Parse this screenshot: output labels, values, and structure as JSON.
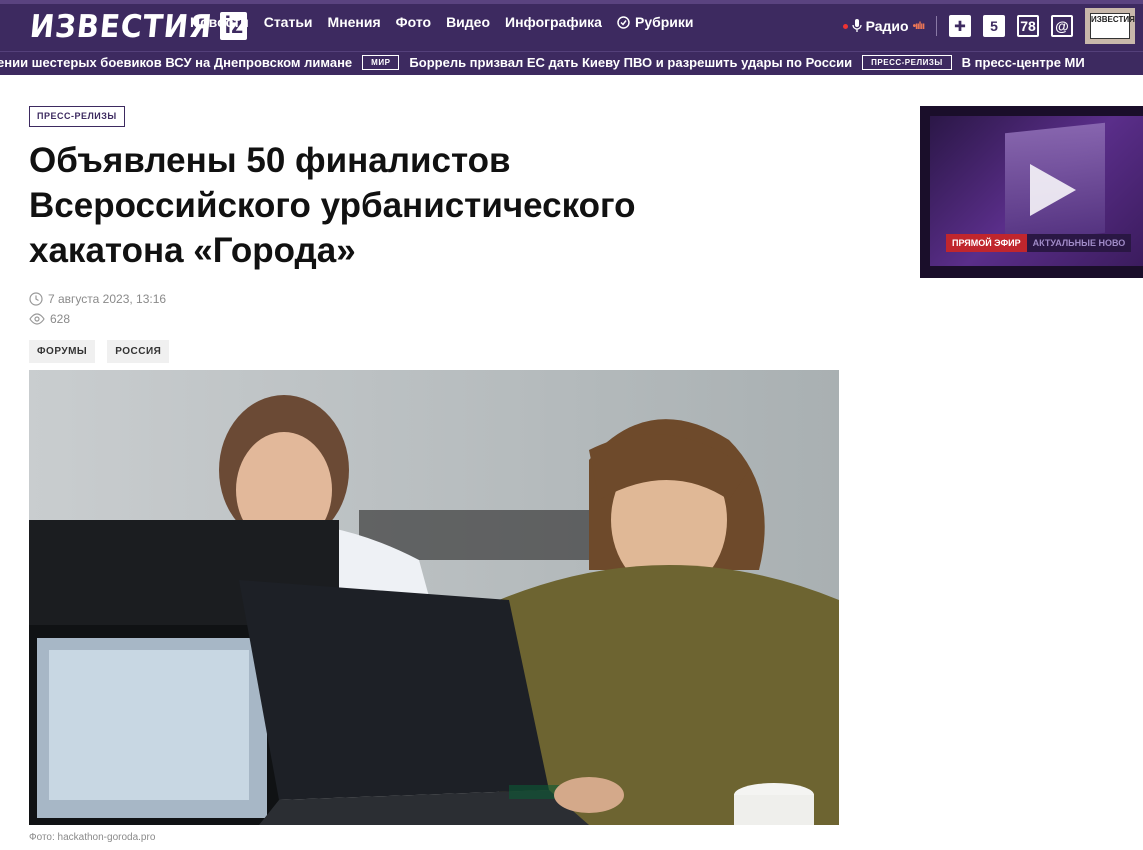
{
  "header": {
    "logo_word": "ИЗВЕСТИЯ",
    "logo_iz": "iz",
    "nav": [
      "Новости",
      "Статьи",
      "Мнения",
      "Фото",
      "Видео",
      "Инфографика"
    ],
    "rubrics_label": "Рубрики",
    "radio_label": "Радио",
    "channel_5": "5",
    "channel_78": "78",
    "izvestia_box": "ИЗВЕСТИЯ",
    "colors": {
      "brand": "#3d2a60",
      "live_red": "#c0262d"
    }
  },
  "ticker": {
    "item1": "ении шестерых боевиков ВСУ на Днепровском лимане",
    "tag1": "МИР",
    "item2": "Боррель призвал ЕС дать Киеву ПВО и разрешить удары по России",
    "tag2": "ПРЕСС-РЕЛИЗЫ",
    "item3": "В пресс-центре МИ"
  },
  "article": {
    "section": "ПРЕСС-РЕЛИЗЫ",
    "title": "Объявлены 50 финалистов Всероссийского урбанистического хакатона «Города»",
    "date": "7 августа 2023, 13:16",
    "views": "628",
    "tags": [
      "ФОРУМЫ",
      "РОССИЯ"
    ],
    "photo_caption": "Фото: hackathon-goroda.pro"
  },
  "video": {
    "live_label": "ПРЯМОЙ ЭФИР",
    "news_label": "АКТУАЛЬНЫЕ НОВО"
  }
}
